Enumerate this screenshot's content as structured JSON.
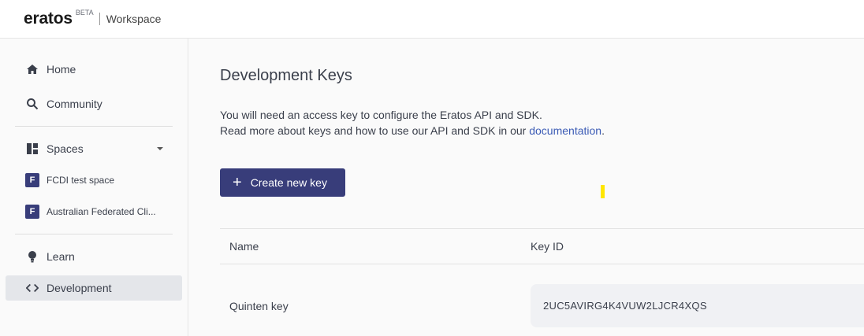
{
  "header": {
    "logo": "eratos",
    "beta": "BETA",
    "workspace": "Workspace"
  },
  "sidebar": {
    "items": [
      {
        "label": "Home",
        "icon": "home-icon"
      },
      {
        "label": "Community",
        "icon": "search-icon"
      }
    ],
    "spaces_label": "Spaces",
    "spaces": [
      {
        "badge": "F",
        "label": "FCDI test space"
      },
      {
        "badge": "F",
        "label": "Australian Federated Cli..."
      }
    ],
    "bottom_items": [
      {
        "label": "Learn",
        "icon": "lightbulb-icon"
      },
      {
        "label": "Development",
        "icon": "code-icon",
        "active": true
      }
    ]
  },
  "main": {
    "title": "Development Keys",
    "desc_line1": "You will need an access key to configure the Eratos API and SDK.",
    "desc_line2_prefix": "Read more about keys and how to use our API and SDK in our ",
    "desc_link": "documentation",
    "desc_suffix": ".",
    "create_button": "Create new key",
    "table": {
      "columns": [
        "Name",
        "Key ID"
      ],
      "rows": [
        {
          "name": "Quinten key",
          "key_id": "2UC5AVIRG4K4VUW2LJCR4XQS"
        }
      ]
    }
  },
  "colors": {
    "accent": "#383d7a",
    "link": "#3b5bb5",
    "highlight": "#ffe600"
  }
}
